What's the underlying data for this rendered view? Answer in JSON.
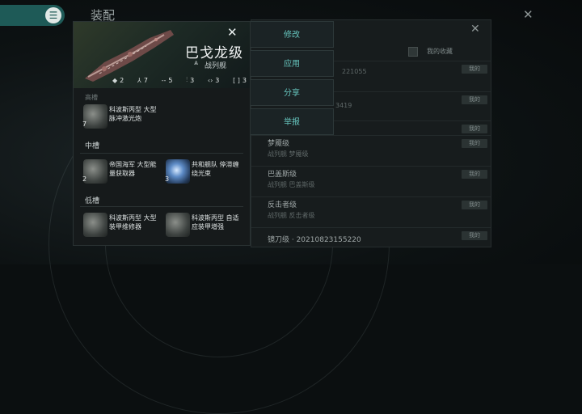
{
  "background": {
    "title": "装配",
    "close_label": "✕",
    "menu_icon": "hamburger-icon"
  },
  "fitting_list": {
    "close_label": "✕",
    "favorite_label": "我的收藏",
    "rows": [
      {
        "name": "",
        "sub": "221055",
        "badge": "我的"
      },
      {
        "name": "",
        "sub": "3419",
        "badge": "我的"
      },
      {
        "name": "",
        "sub": "",
        "badge": "我的"
      },
      {
        "name": "梦魇级",
        "sub": "战列舰 梦魇级",
        "badge": "我的"
      },
      {
        "name": "巴盖斯级",
        "sub": "战列舰 巴盖斯级",
        "badge": "我的"
      },
      {
        "name": "反击者级",
        "sub": "战列舰 反击者级",
        "badge": "我的"
      },
      {
        "name": "镜刀级 · 20210823155220",
        "sub": "",
        "badge": "我的"
      }
    ]
  },
  "actions": {
    "modify": "修改",
    "apply": "应用",
    "share": "分享",
    "report": "举报"
  },
  "ship": {
    "name": "巴戈龙级",
    "class": "战列舰",
    "close_label": "✕",
    "stats": [
      {
        "icon": "turret-icon",
        "glyph": "◆",
        "value": "2"
      },
      {
        "icon": "launcher-icon",
        "glyph": "⅄",
        "value": "7"
      },
      {
        "icon": "high-slot-icon",
        "glyph": "--",
        "value": "5"
      },
      {
        "icon": "mid-slot-icon",
        "glyph": "⫶",
        "value": "3"
      },
      {
        "icon": "rig-icon",
        "glyph": "‹›",
        "value": "3"
      },
      {
        "icon": "low-slot-icon",
        "glyph": "[ ]",
        "value": "3"
      }
    ],
    "high_slot_label": "高槽",
    "mid_slot_label": "中槽",
    "low_slot_label": "低槽",
    "high_modules": [
      {
        "name": "科波斯丙型 大型脉冲激光炮",
        "count": "7"
      }
    ],
    "mid_modules": [
      {
        "name": "帝国海军 大型能量获取器",
        "count": "2"
      },
      {
        "name": "共和舰队 停滞缠绕光束",
        "count": "3"
      }
    ],
    "low_modules": [
      {
        "name": "科波斯丙型 大型装甲维修器",
        "count": ""
      },
      {
        "name": "科波斯丙型 自适应装甲增强",
        "count": ""
      }
    ]
  }
}
